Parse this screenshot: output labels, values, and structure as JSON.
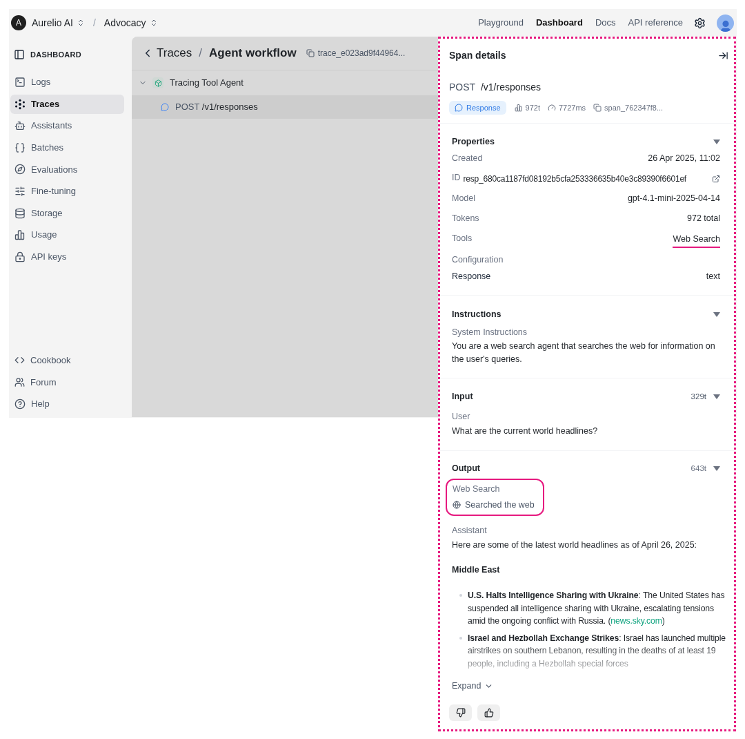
{
  "topbar": {
    "org_initial": "A",
    "org": "Aurelio AI",
    "separator": "/",
    "project": "Advocacy",
    "nav": [
      {
        "label": "Playground",
        "selected": false
      },
      {
        "label": "Dashboard",
        "selected": true
      },
      {
        "label": "Docs",
        "selected": false
      },
      {
        "label": "API reference",
        "selected": false
      }
    ]
  },
  "sidebar": {
    "title": "DASHBOARD",
    "items": [
      {
        "label": "Logs",
        "selected": false
      },
      {
        "label": "Traces",
        "selected": true
      },
      {
        "label": "Assistants",
        "selected": false
      },
      {
        "label": "Batches",
        "selected": false
      },
      {
        "label": "Evaluations",
        "selected": false
      },
      {
        "label": "Fine-tuning",
        "selected": false
      },
      {
        "label": "Storage",
        "selected": false
      },
      {
        "label": "Usage",
        "selected": false
      },
      {
        "label": "API keys",
        "selected": false
      }
    ],
    "footer_items": [
      {
        "label": "Cookbook"
      },
      {
        "label": "Forum"
      },
      {
        "label": "Help"
      }
    ]
  },
  "trace": {
    "back": "Traces",
    "separator": "/",
    "title": "Agent workflow",
    "id": "trace_e023ad9f44964...",
    "tree": [
      {
        "label": "Tracing Tool Agent",
        "expanded": true,
        "selected": false,
        "children": [
          {
            "method": "POST",
            "path": "/v1/responses",
            "selected": true
          }
        ]
      }
    ]
  },
  "span": {
    "title": "Span details",
    "method": "POST",
    "path": "/v1/responses",
    "badge": "Response",
    "tokens": "972t",
    "duration": "7727ms",
    "span_id": "span_762347f8...",
    "properties": {
      "title": "Properties",
      "rows": [
        {
          "kind": "row",
          "label": "Created",
          "value": "26 Apr 2025, 11:02"
        },
        {
          "kind": "id",
          "label": "ID",
          "value": "resp_680ca1187fd08192b5cfa253336635b40e3c89390f6601ef"
        },
        {
          "kind": "row",
          "label": "Model",
          "value": "gpt-4.1-mini-2025-04-14"
        },
        {
          "kind": "row",
          "label": "Tokens",
          "value": "972 total"
        },
        {
          "kind": "highlight",
          "label": "Tools",
          "value": "Web Search"
        },
        {
          "kind": "heading",
          "label": "Configuration"
        },
        {
          "kind": "strong",
          "label": "Response",
          "value": "text"
        }
      ]
    },
    "instructions": {
      "title": "Instructions",
      "label": "System Instructions",
      "text": "You are a web search agent that searches the web for information on the user's queries."
    },
    "input": {
      "title": "Input",
      "count": "329t",
      "label": "User",
      "text": "What are the current world headlines?"
    },
    "output": {
      "title": "Output",
      "count": "643t",
      "tool_label": "Web Search",
      "tool_text": "Searched the web",
      "label": "Assistant",
      "intro": "Here are some of the latest world headlines as of April 26, 2025:",
      "heading": "Middle East",
      "bullets": [
        {
          "text": "**U.S. Halts Intelligence Sharing with Ukraine**: The United States has suspended all intelligence sharing with Ukraine, escalating tensions amid the ongoing conflict with Russia. (",
          "link": "news.sky.com",
          "after": ")"
        },
        {
          "text": "**Israel and Hezbollah Exchange Strikes**: Israel has launched multiple airstrikes on southern Lebanon, resulting in the deaths of at least 19 people, including a Hezbollah special forces"
        }
      ],
      "expand": "Expand"
    }
  }
}
